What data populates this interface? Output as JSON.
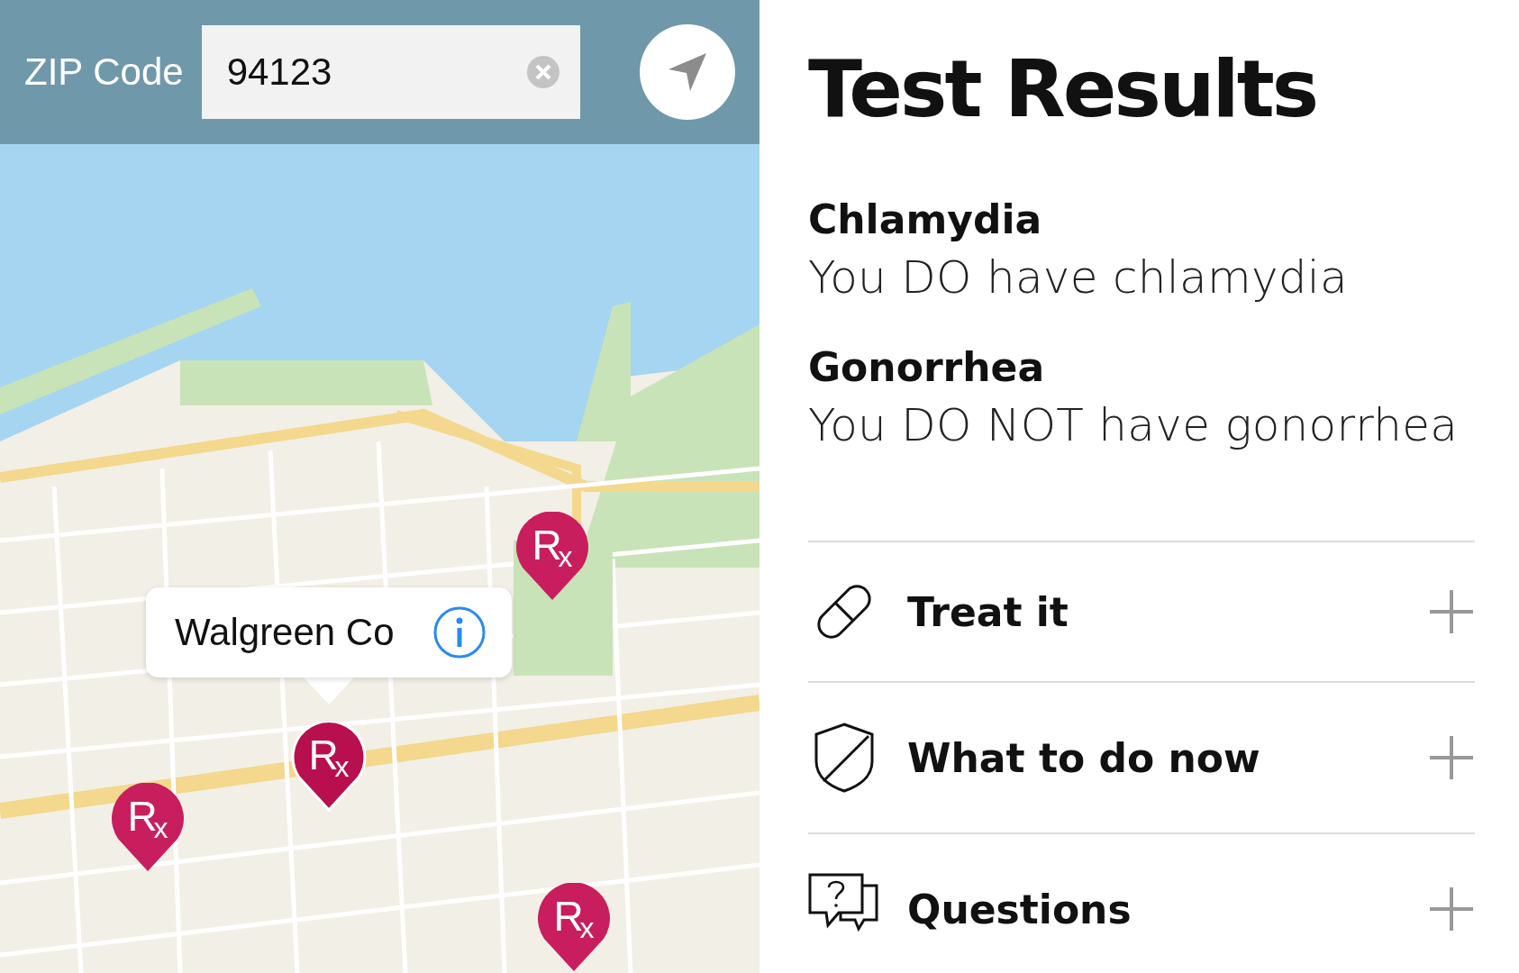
{
  "map_screen": {
    "zip_label": "ZIP Code",
    "zip_field": {
      "value": "94123"
    },
    "pins": [
      {
        "glyph": "R$_{x}$",
        "selected": false
      },
      {
        "glyph": "R$_{x}$",
        "selected": true
      },
      {
        "glyph": "R$_{x}$",
        "selected": false
      },
      {
        "glyph": "R$_{x}$",
        "selected": false
      }
    ],
    "callout": {
      "title": "Walgreen Co"
    }
  },
  "results_screen": {
    "title": "Test Results",
    "results": [
      {
        "condition": "Chlamydia",
        "result": "You DO have chlamydia"
      },
      {
        "condition": "Gonorrhea",
        "result": "You DO NOT have gonorrhea"
      }
    ],
    "sections": [
      {
        "kind": "pill",
        "label": "Treat it",
        "expanded": false
      },
      {
        "kind": "shield",
        "label": "What to do now",
        "expanded": false
      },
      {
        "kind": "questions",
        "label": "Questions",
        "expanded": false
      }
    ]
  }
}
